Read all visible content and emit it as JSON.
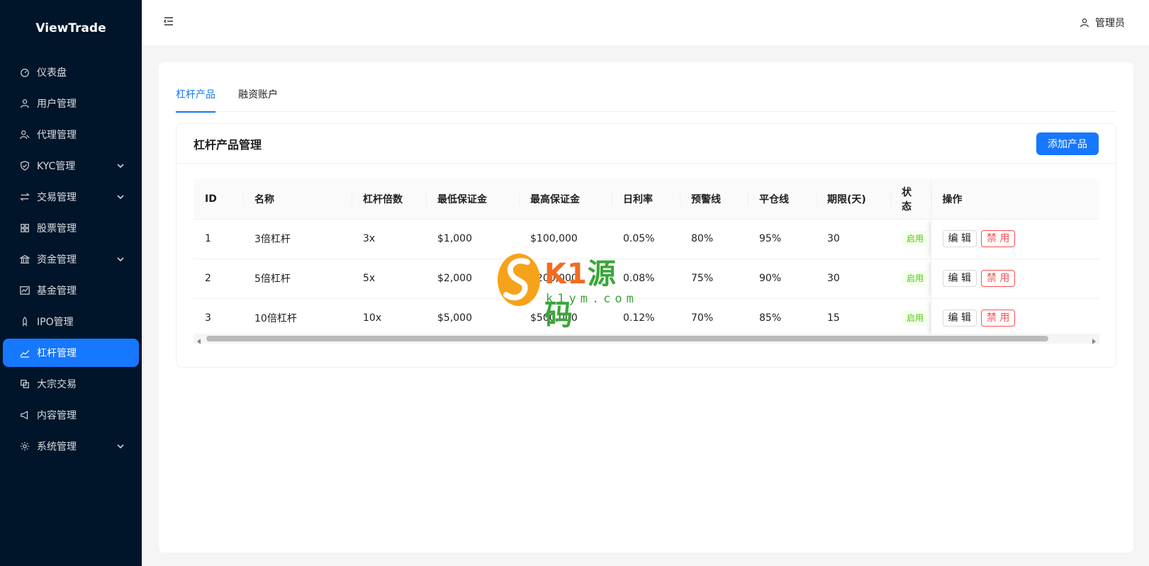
{
  "app": {
    "brand": "ViewTrade"
  },
  "sidebar": {
    "items": [
      {
        "label": "仪表盘",
        "icon": "dashboard-icon",
        "has_children": false
      },
      {
        "label": "用户管理",
        "icon": "user-icon",
        "has_children": false
      },
      {
        "label": "代理管理",
        "icon": "agent-icon",
        "has_children": false
      },
      {
        "label": "KYC管理",
        "icon": "shield-check-icon",
        "has_children": true
      },
      {
        "label": "交易管理",
        "icon": "swap-icon",
        "has_children": true
      },
      {
        "label": "股票管理",
        "icon": "grid-icon",
        "has_children": false
      },
      {
        "label": "资金管理",
        "icon": "bank-icon",
        "has_children": true
      },
      {
        "label": "基金管理",
        "icon": "stock-chart-icon",
        "has_children": false
      },
      {
        "label": "IPO管理",
        "icon": "rocket-icon",
        "has_children": false
      },
      {
        "label": "杠杆管理",
        "icon": "line-chart-icon",
        "has_children": false,
        "active": true
      },
      {
        "label": "大宗交易",
        "icon": "block-icon",
        "has_children": false
      },
      {
        "label": "内容管理",
        "icon": "notification-icon",
        "has_children": false
      },
      {
        "label": "系统管理",
        "icon": "setting-icon",
        "has_children": true
      }
    ]
  },
  "header": {
    "user_label": "管理员"
  },
  "tabs": [
    {
      "label": "杠杆产品",
      "active": true
    },
    {
      "label": "融资账户",
      "active": false
    }
  ],
  "card": {
    "title": "杠杆产品管理",
    "add_button": "添加产品"
  },
  "table": {
    "columns": [
      "ID",
      "名称",
      "杠杆倍数",
      "最低保证金",
      "最高保证金",
      "日利率",
      "预警线",
      "平仓线",
      "期限(天)",
      "状态",
      "操作"
    ],
    "rows": [
      {
        "id": "1",
        "name": "3倍杠杆",
        "leverage": "3x",
        "min_margin": "$1,000",
        "max_margin": "$100,000",
        "daily_rate": "0.05%",
        "warning_line": "80%",
        "liquidation_line": "95%",
        "term": "30",
        "status": "启用"
      },
      {
        "id": "2",
        "name": "5倍杠杆",
        "leverage": "5x",
        "min_margin": "$2,000",
        "max_margin": "$200,000",
        "daily_rate": "0.08%",
        "warning_line": "75%",
        "liquidation_line": "90%",
        "term": "30",
        "status": "启用"
      },
      {
        "id": "3",
        "name": "10倍杠杆",
        "leverage": "10x",
        "min_margin": "$5,000",
        "max_margin": "$500,000",
        "daily_rate": "0.12%",
        "warning_line": "70%",
        "liquidation_line": "85%",
        "term": "15",
        "status": "启用"
      }
    ],
    "actions": {
      "edit": "编 辑",
      "disable": "禁 用"
    }
  },
  "watermark": {
    "text_a": "K1",
    "text_b": "源码",
    "sub": "k1ym.com"
  },
  "colors": {
    "sidebar_bg": "#001529",
    "primary": "#1677ff",
    "danger": "#ff4d4f",
    "success": "#52c41a"
  }
}
